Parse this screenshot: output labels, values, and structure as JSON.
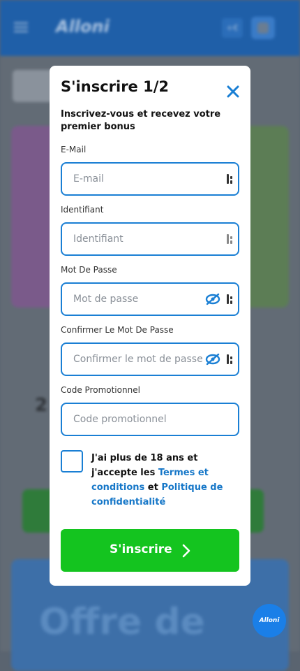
{
  "background": {
    "logo_text": "Alloni",
    "top_button_label": "+€",
    "banner_partial_text": "2",
    "card_partial_text": "Offre de"
  },
  "modal": {
    "title": "S'inscrire 1/2",
    "subtitle": "Inscrivez-vous et recevez votre premier bonus",
    "close_icon": "close-icon",
    "fields": {
      "email": {
        "label": "E-Mail",
        "placeholder": "E-mail",
        "value": ""
      },
      "identifiant": {
        "label": "Identifiant",
        "placeholder": "Identifiant",
        "value": ""
      },
      "password": {
        "label": "Mot De Passe",
        "placeholder": "Mot de passe",
        "value": ""
      },
      "confirm_password": {
        "label": "Confirmer Le Mot De Passe",
        "placeholder": "Confirmer le mot de passe",
        "value": ""
      },
      "promo": {
        "label": "Code Promotionnel",
        "placeholder": "Code promotionnel",
        "value": ""
      }
    },
    "terms": {
      "checked": false,
      "text_before": "J'ai plus de 18 ans et j'accepte les ",
      "terms_link": "Termes et conditions",
      "text_middle": " et ",
      "privacy_link": "Politique de confidentialité"
    },
    "submit_label": "S'inscrire"
  },
  "chat_fab": {
    "label": "Alloni"
  },
  "colors": {
    "accent": "#1a7fd4",
    "submit": "#14c41f",
    "link": "#1677c8",
    "header": "#1f5fa8"
  }
}
